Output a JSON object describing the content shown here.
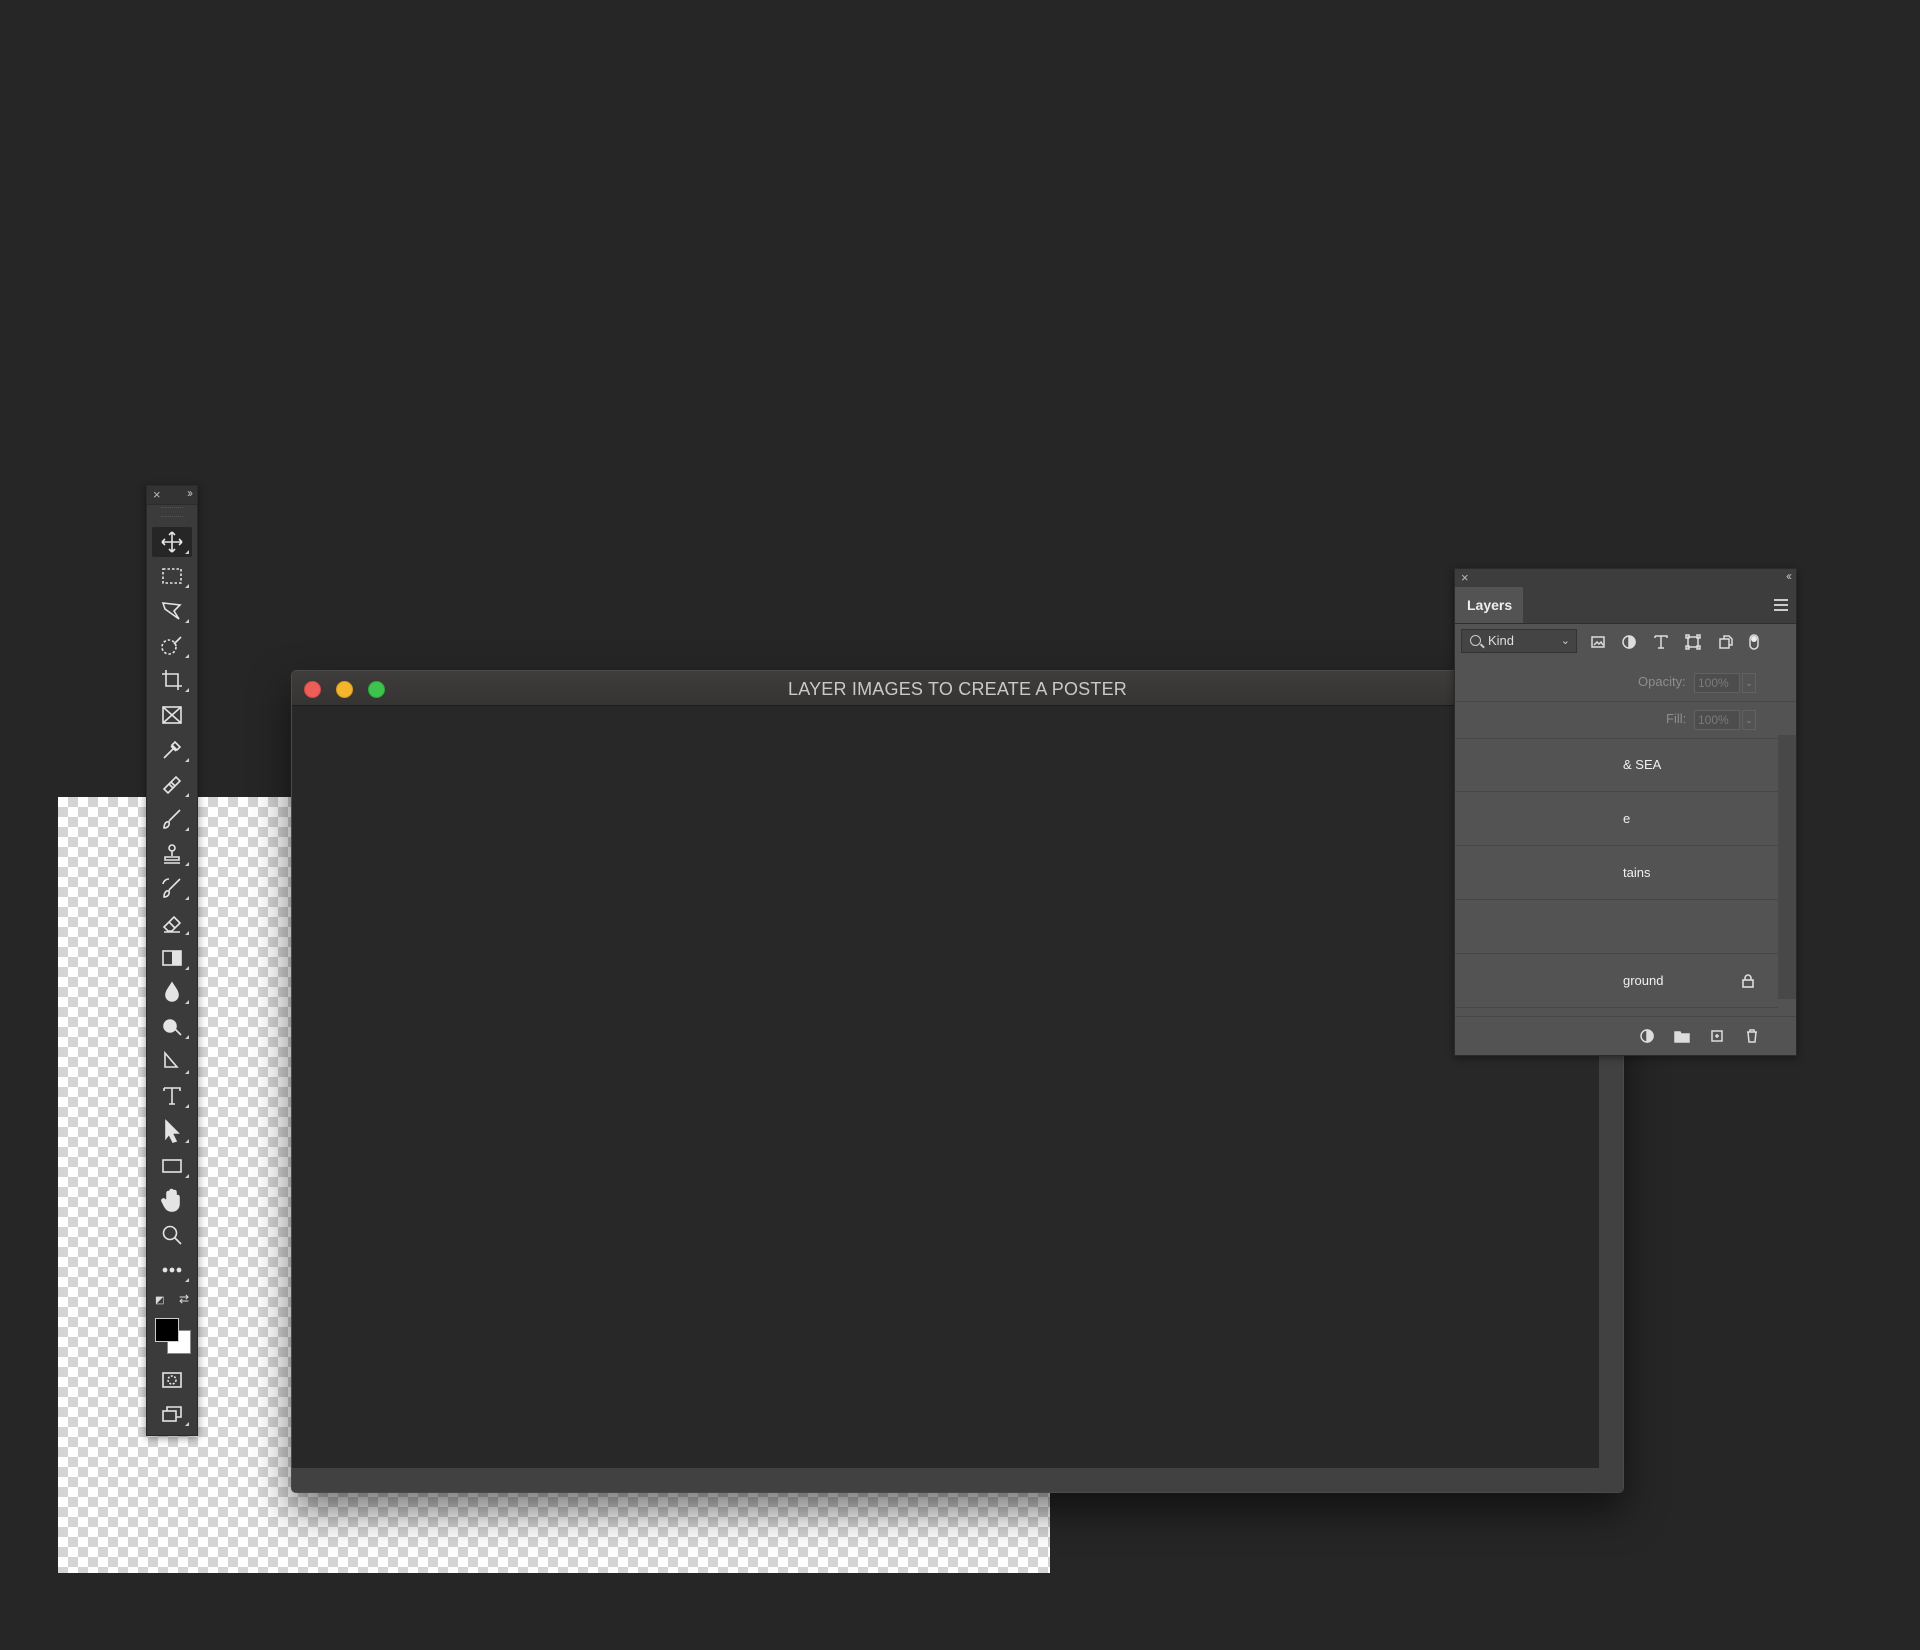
{
  "document": {
    "title": "LAYER IMAGES TO CREATE A POSTER"
  },
  "tools_panel": {
    "close_glyph": "×",
    "collapse_glyph": "››",
    "tools": [
      {
        "name": "move-tool",
        "icon": "move-icon",
        "active": true
      },
      {
        "name": "marquee-tool",
        "icon": "rectangular-marquee-icon"
      },
      {
        "name": "lasso-tool",
        "icon": "polygonal-lasso-icon"
      },
      {
        "name": "quick-selection-tool",
        "icon": "quick-selection-icon"
      },
      {
        "name": "crop-tool",
        "icon": "crop-icon"
      },
      {
        "name": "frame-tool",
        "icon": "frame-icon"
      },
      {
        "name": "eyedropper-tool",
        "icon": "eyedropper-icon"
      },
      {
        "name": "healing-brush-tool",
        "icon": "bandage-icon"
      },
      {
        "name": "brush-tool",
        "icon": "brush-icon"
      },
      {
        "name": "clone-stamp-tool",
        "icon": "stamp-icon"
      },
      {
        "name": "history-brush-tool",
        "icon": "history-brush-icon"
      },
      {
        "name": "eraser-tool",
        "icon": "eraser-icon"
      },
      {
        "name": "gradient-tool",
        "icon": "gradient-icon"
      },
      {
        "name": "blur-tool",
        "icon": "drop-icon"
      },
      {
        "name": "dodge-tool",
        "icon": "dodge-icon"
      },
      {
        "name": "pen-tool",
        "icon": "pen-icon"
      },
      {
        "name": "type-tool",
        "icon": "type-icon"
      },
      {
        "name": "path-selection-tool",
        "icon": "arrow-cursor-icon"
      },
      {
        "name": "rectangle-tool",
        "icon": "rectangle-icon"
      },
      {
        "name": "hand-tool",
        "icon": "hand-icon"
      },
      {
        "name": "zoom-tool",
        "icon": "magnifier-icon"
      },
      {
        "name": "edit-toolbar",
        "icon": "more-icon"
      }
    ],
    "foreground_color": "#000000",
    "background_color": "#ffffff"
  },
  "layers_panel": {
    "close_glyph": "×",
    "collapse_glyph": "‹‹",
    "tab_label": "Layers",
    "filter_label": "Kind",
    "opacity_label": "Opacity:",
    "opacity_value": "100%",
    "fill_label": "Fill:",
    "fill_value": "100%",
    "layers": [
      {
        "label": "& SEA"
      },
      {
        "label": "e"
      },
      {
        "label": "tains"
      },
      {
        "label": ""
      },
      {
        "label": "ground",
        "locked": true
      }
    ]
  },
  "colors": {
    "app_background": "#262626",
    "panel": "#535353",
    "traffic_red": "#ee5e58",
    "traffic_yellow": "#f2b52c",
    "traffic_green": "#3fc34f"
  }
}
